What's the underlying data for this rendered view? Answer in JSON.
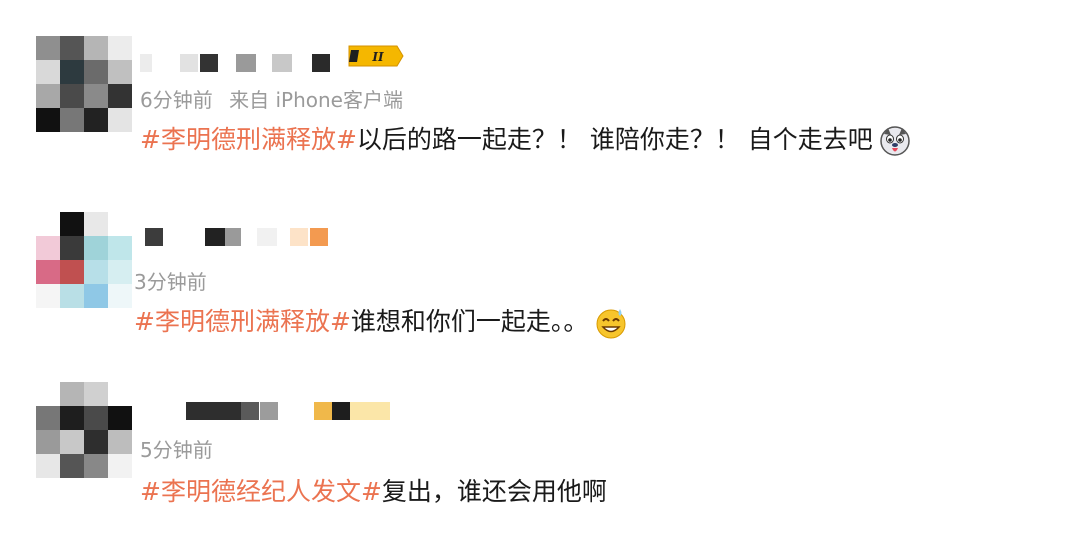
{
  "comments": [
    {
      "time": "6分钟前",
      "source": "来自 iPhone客户端",
      "topic": "#李明德刑满释放#",
      "text": "以后的路一起走？！ 谁陪你走？！ 自个走去吧",
      "emoji_icon": "dog-face-tongue-emoji",
      "badge_text": "II"
    },
    {
      "time": "3分钟前",
      "topic": "#李明德刑满释放#",
      "text": "谁想和你们一起走。。",
      "emoji_icon": "grinning-sweat-emoji"
    },
    {
      "time": "5分钟前",
      "topic": "#李明德经纪人发文#",
      "text": "复出，谁还会用他啊"
    }
  ],
  "colors": {
    "topic": "#eb7350",
    "meta": "#9a9a9a",
    "text": "#1a1a1a",
    "badge": "#f5b700"
  }
}
